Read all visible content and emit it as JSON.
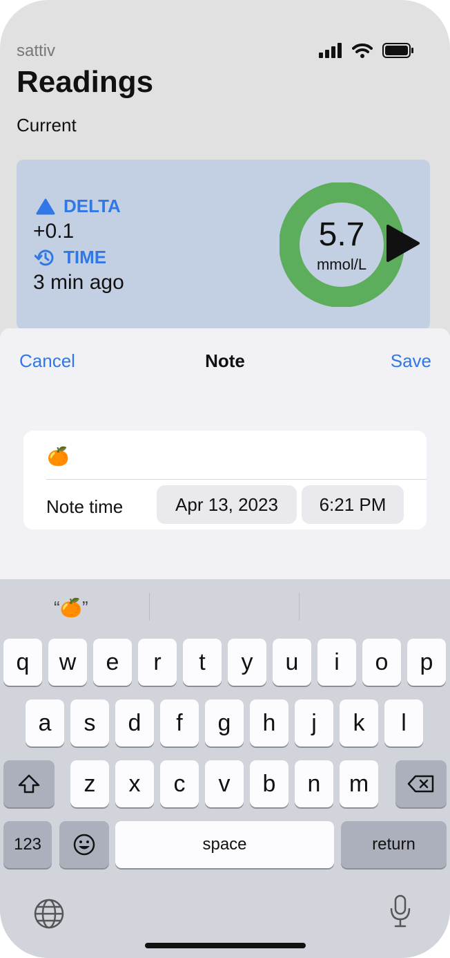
{
  "status_bar": {
    "carrier": "sattiv",
    "signal_icon": "signal-bars-icon",
    "wifi_icon": "wifi-icon",
    "battery_icon": "battery-icon"
  },
  "page": {
    "title": "Readings",
    "section": "Current"
  },
  "current_card": {
    "delta_label": "DELTA",
    "delta_value": "+0.1",
    "time_label": "TIME",
    "time_value": "3 min ago",
    "glucose_value": "5.7",
    "glucose_unit": "mmol/L",
    "ring_color": "#5cae5c",
    "card_color": "#c3cfe2",
    "accent_color": "#2f78e6"
  },
  "note_sheet": {
    "cancel": "Cancel",
    "title": "Note",
    "save": "Save",
    "note_text": "🍊",
    "note_time_label": "Note time",
    "date": "Apr 13, 2023",
    "time": "6:21 PM"
  },
  "keyboard": {
    "suggestion": "“🍊”",
    "row1": [
      "q",
      "w",
      "e",
      "r",
      "t",
      "y",
      "u",
      "i",
      "o",
      "p"
    ],
    "row2": [
      "a",
      "s",
      "d",
      "f",
      "g",
      "h",
      "j",
      "k",
      "l"
    ],
    "row3": [
      "z",
      "x",
      "c",
      "v",
      "b",
      "n",
      "m"
    ],
    "numbers": "123",
    "space": "space",
    "return": "return"
  }
}
